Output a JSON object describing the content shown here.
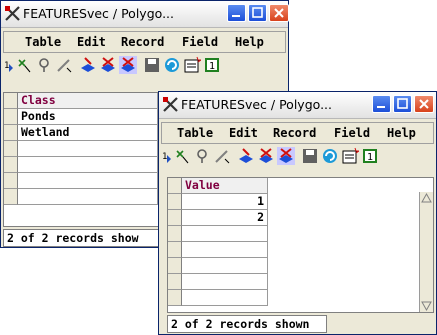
{
  "back_window": {
    "title": "FEATURESvec / Polygo...",
    "menu": [
      "Table",
      "Edit",
      "Record",
      "Field",
      "Help"
    ],
    "column_header": "Class",
    "rows": [
      "Ponds",
      "Wetland",
      "",
      "",
      "",
      ""
    ],
    "status": "2 of 2 records show"
  },
  "front_window": {
    "title": "FEATURESvec / Polygo...",
    "menu": [
      "Table",
      "Edit",
      "Record",
      "Field",
      "Help"
    ],
    "column_header": "Value",
    "rows": [
      "1",
      "2",
      "",
      "",
      "",
      "",
      ""
    ],
    "status": "2 of 2 records shown"
  },
  "colors": {
    "title_blue": "#1c4ed8",
    "close_red": "#d8421c",
    "header_text": "#800040"
  }
}
